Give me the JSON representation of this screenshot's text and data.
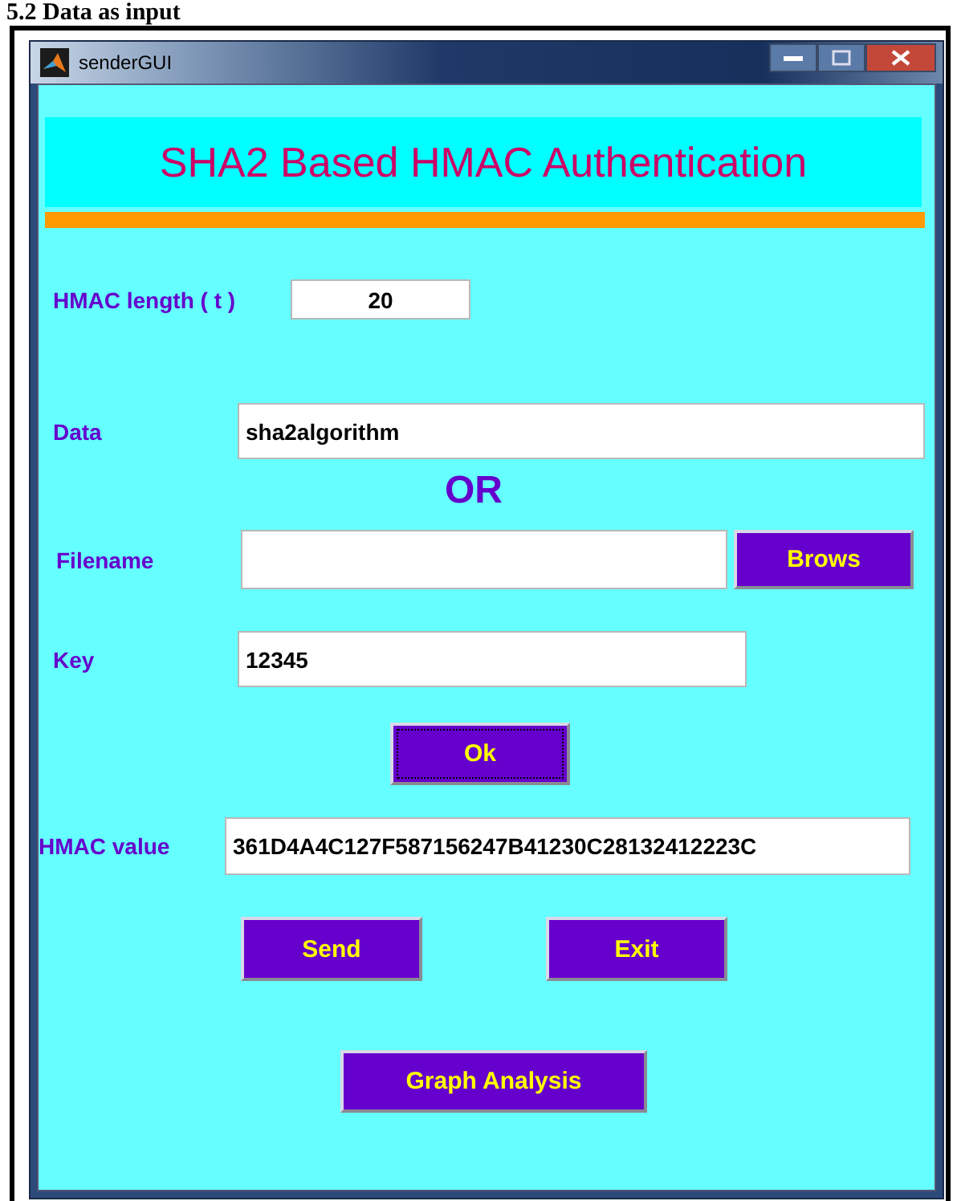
{
  "caption": "5.2 Data as input",
  "window": {
    "title": "senderGUI"
  },
  "banner": "SHA2 Based HMAC Authentication",
  "hmac_length": {
    "label": "HMAC length ( t )",
    "value": "20"
  },
  "data": {
    "label": "Data",
    "value": "sha2algorithm"
  },
  "separator": "OR",
  "filename": {
    "label": "Filename",
    "button": {
      "label": "Brows",
      "focused": false
    }
  },
  "key": {
    "label": "Key",
    "value": "12345"
  },
  "ok_button": {
    "label": "Ok",
    "focused": true
  },
  "hmac_value": {
    "label": "HMAC value",
    "value": "361D4A4C127F587156247B41230C28132412223C"
  },
  "send_button": {
    "label": "Send",
    "focused": false
  },
  "exit_button": {
    "label": "Exit",
    "focused": false
  },
  "graph_button": {
    "label": "Graph Analysis",
    "focused": false
  }
}
